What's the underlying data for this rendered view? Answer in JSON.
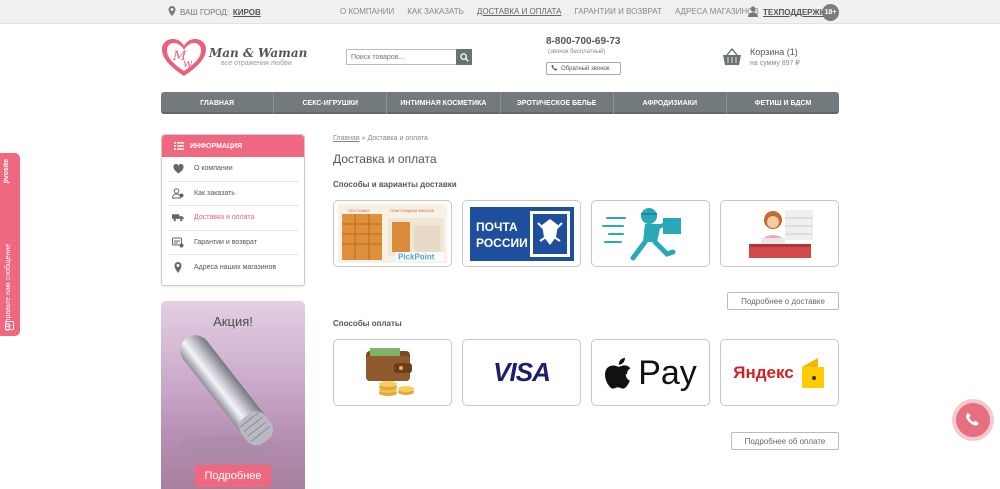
{
  "topbar": {
    "city_label": "ВАШ ГОРОД:",
    "city_name": "КИРОВ",
    "links": [
      "О КОМПАНИИ",
      "КАК ЗАКАЗАТЬ",
      "ДОСТАВКА И ОПЛАТА",
      "ГАРАНТИИ И ВОЗВРАТ",
      "АДРЕСА МАГАЗИНОВ"
    ],
    "support": "ТЕХПОДДЕРЖКА",
    "age": "18+"
  },
  "header": {
    "logo_text": "Man & Waman",
    "logo_sub": "все отражения любви",
    "search_placeholder": "Поиск товаров...",
    "phone": "8-800-700-69-73",
    "phone_note": "(звонок бесплатный)",
    "callback": "Обратный звонок",
    "cart_label": "Корзина (1)",
    "cart_sum": "на сумму 897 ₽"
  },
  "mainnav": [
    "ГЛАВНАЯ",
    "СЕКС-ИГРУШКИ",
    "ИНТИМНАЯ КОСМЕТИКА",
    "ЭРОТИЧЕСКОЕ БЕЛЬЕ",
    "АФРОДИЗИАКИ",
    "ФЕТИШ И БДСМ"
  ],
  "sidebar": {
    "title": "ИНФОРМАЦИЯ",
    "items": [
      {
        "label": "О компании",
        "icon": "heart-icon"
      },
      {
        "label": "Как заказать",
        "icon": "user-order-icon"
      },
      {
        "label": "Доставка и оплата",
        "icon": "truck-icon"
      },
      {
        "label": "Гарантии и возврат",
        "icon": "guarantee-icon"
      },
      {
        "label": "Адреса наших магазинов",
        "icon": "location-pin-icon"
      }
    ]
  },
  "promo": {
    "title": "Акция!",
    "button": "Подробнее"
  },
  "content": {
    "crumb_home": "Главная",
    "crumb_sep": " » ",
    "crumb_current": "Доставка и оплата",
    "page_title": "Доставка и оплата",
    "delivery_title": "Способы и варианты доставки",
    "delivery_more": "Подробнее о доставке",
    "payment_title": "Способы оплаты",
    "payment_more": "Подробнее об оплате",
    "pickpoint_top1": "ПОСТАМАТ",
    "pickpoint_top2": "ПУНКТ ВЫДАЧИ ЗАКАЗОВ",
    "pickpoint_brand": "PickPoint",
    "pochta_line1": "ПОЧТА",
    "pochta_line2": "РОССИИ",
    "visa": "VISA",
    "applepay": "Pay",
    "yandex": "Яндекс"
  },
  "float_tab": {
    "text": "Отправьте нам сообщение",
    "brand": "jivosite"
  },
  "colors": {
    "accent": "#f0687f",
    "nav": "#737a7d",
    "pochta_blue": "#1e4f9d",
    "courier_teal": "#2aa7b8",
    "visa_blue": "#1a1f71",
    "yandex_yellow": "#ffcc00"
  }
}
